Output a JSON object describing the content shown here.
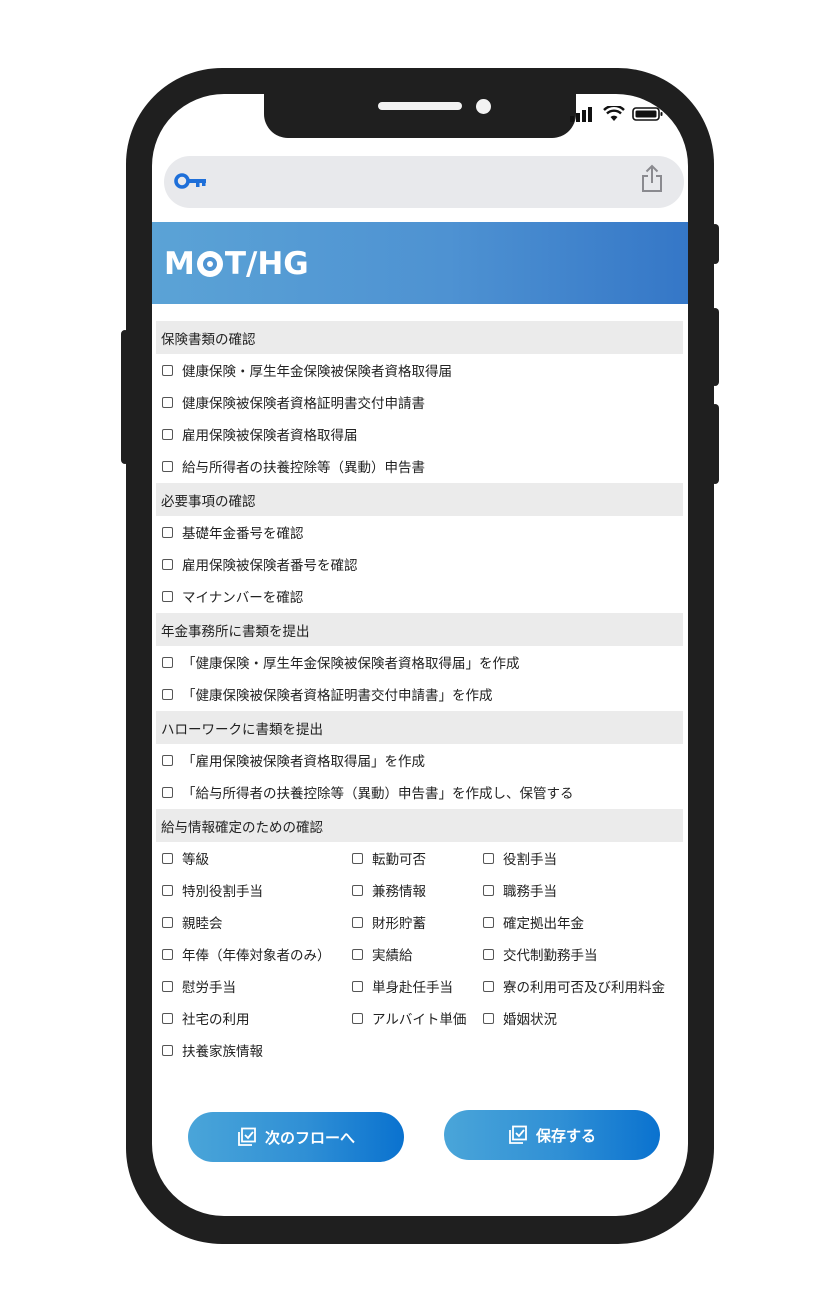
{
  "app": {
    "logo_text_left": "M",
    "logo_text_right": "T/HG"
  },
  "address_bar": {
    "key_icon": "key-icon",
    "share_icon": "share-icon"
  },
  "sections": [
    {
      "title": "保険書類の確認",
      "items": [
        "健康保険・厚生年金保険被保険者資格取得届",
        "健康保険被保険者資格証明書交付申請書",
        "雇用保険被保険者資格取得届",
        "給与所得者の扶養控除等（異動）申告書"
      ]
    },
    {
      "title": "必要事項の確認",
      "items": [
        "基礎年金番号を確認",
        "雇用保険被保険者番号を確認",
        "マイナンバーを確認"
      ]
    },
    {
      "title": "年金事務所に書類を提出",
      "items": [
        "「健康保険・厚生年金保険被保険者資格取得届」を作成",
        "「健康保険被保険者資格証明書交付申請書」を作成"
      ]
    },
    {
      "title": "ハローワークに書類を提出",
      "items": [
        "「雇用保険被保険者資格取得届」を作成",
        "「給与所得者の扶養控除等（異動）申告書」を作成し、保管する"
      ]
    },
    {
      "title": "給与情報確定のための確認",
      "grid": [
        [
          "等級",
          "転勤可否",
          "役割手当"
        ],
        [
          "特別役割手当",
          "兼務情報",
          "職務手当"
        ],
        [
          "親睦会",
          "財形貯蓄",
          "確定拠出年金"
        ],
        [
          "年俸（年俸対象者のみ）",
          "実績給",
          "交代制勤務手当"
        ],
        [
          "慰労手当",
          "単身赴任手当",
          "寮の利用可否及び利用料金"
        ],
        [
          "社宅の利用",
          "アルバイト単価",
          "婚姻状況"
        ],
        [
          "扶養家族情報"
        ]
      ]
    }
  ],
  "buttons": {
    "next_flow": "次のフローへ",
    "save": "保存する"
  },
  "colors": {
    "banner_start": "#5ba3d6",
    "banner_end": "#3577c7",
    "button_end": "#0a72cf",
    "section_bg": "#ebebeb"
  }
}
